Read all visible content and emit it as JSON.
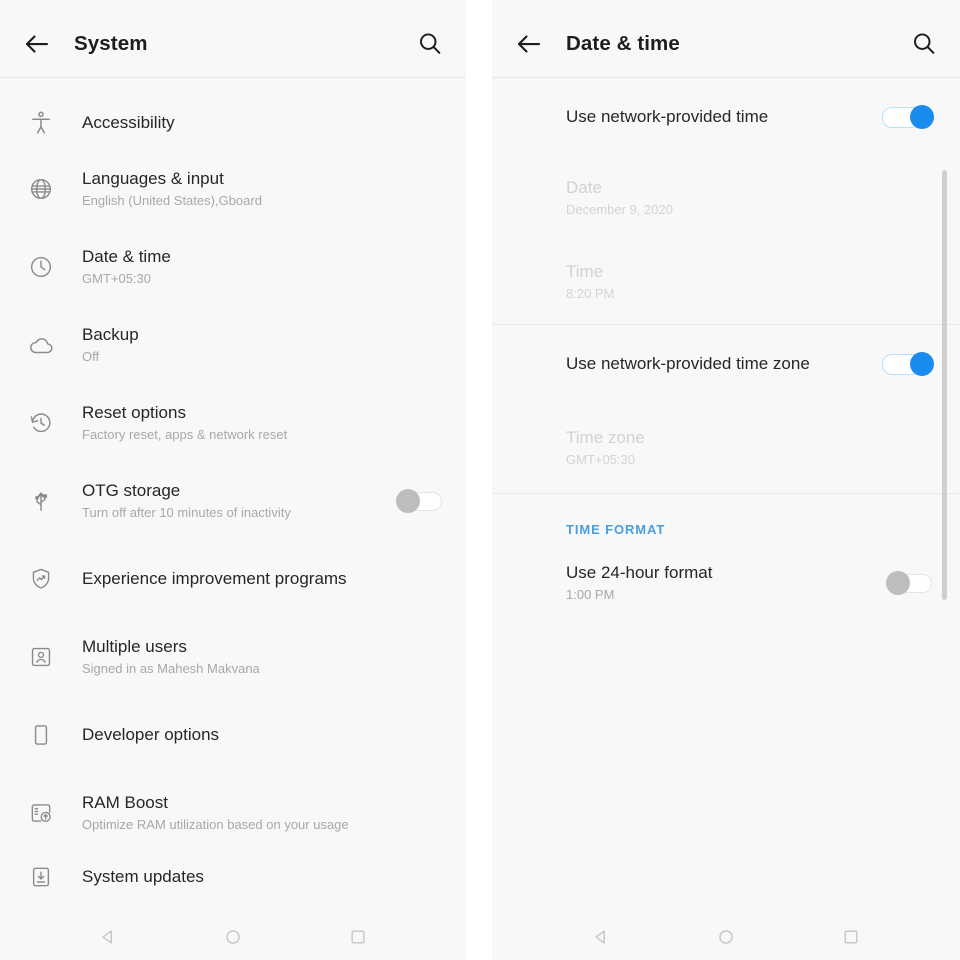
{
  "left_panel": {
    "appbar": {
      "back_icon": "arrow-left-icon",
      "title": "System",
      "search_icon": "search-icon"
    },
    "items": [
      {
        "icon": "accessibility-icon",
        "title": "Accessibility",
        "subtitle": ""
      },
      {
        "icon": "globe-icon",
        "title": "Languages & input",
        "subtitle": "English (United States),Gboard"
      },
      {
        "icon": "clock-icon",
        "title": "Date & time",
        "subtitle": "GMT+05:30"
      },
      {
        "icon": "cloud-icon",
        "title": "Backup",
        "subtitle": "Off"
      },
      {
        "icon": "history-restore-icon",
        "title": "Reset options",
        "subtitle": "Factory reset, apps & network reset"
      },
      {
        "icon": "usb-icon",
        "title": "OTG storage",
        "subtitle": "Turn off after 10 minutes of inactivity",
        "toggle": "off"
      },
      {
        "icon": "shield-trend-icon",
        "title": "Experience improvement programs",
        "subtitle": ""
      },
      {
        "icon": "user-box-icon",
        "title": "Multiple users",
        "subtitle": "Signed in as Mahesh Makvana"
      },
      {
        "icon": "phone-outline-icon",
        "title": "Developer options",
        "subtitle": ""
      },
      {
        "icon": "ram-boost-icon",
        "title": "RAM Boost",
        "subtitle": "Optimize RAM utilization based on your usage"
      },
      {
        "icon": "system-update-icon",
        "title": "System updates",
        "subtitle": ""
      }
    ],
    "navbar": {
      "back": "nav-back-triangle-icon",
      "home": "nav-home-circle-icon",
      "recents": "nav-recents-square-icon"
    }
  },
  "right_panel": {
    "appbar": {
      "back_icon": "arrow-left-icon",
      "title": "Date & time",
      "search_icon": "search-icon"
    },
    "items": [
      {
        "title": "Use network-provided time",
        "subtitle": "",
        "toggle": "on",
        "dimmed": false
      },
      {
        "title": "Date",
        "subtitle": "December 9, 2020",
        "dimmed": true
      },
      {
        "title": "Time",
        "subtitle": "8:20 PM",
        "dimmed": true
      },
      {
        "title": "Use network-provided time zone",
        "subtitle": "",
        "toggle": "on",
        "dimmed": false
      },
      {
        "title": "Time zone",
        "subtitle": "GMT+05:30",
        "dimmed": true
      }
    ],
    "section_header": "TIME FORMAT",
    "format_item": {
      "title": "Use 24-hour format",
      "subtitle": "1:00 PM",
      "toggle": "off"
    },
    "navbar": {
      "back": "nav-back-triangle-icon",
      "home": "nav-home-circle-icon",
      "recents": "nav-recents-square-icon"
    }
  },
  "colors": {
    "accent_blue": "#1a8cf0",
    "section_header_blue": "#4a9fe0",
    "toggle_off_gray": "#bdbdbd",
    "panel_bg": "#f8f8f8",
    "title_text": "#262626",
    "subtitle_text": "#a8a8a8"
  }
}
